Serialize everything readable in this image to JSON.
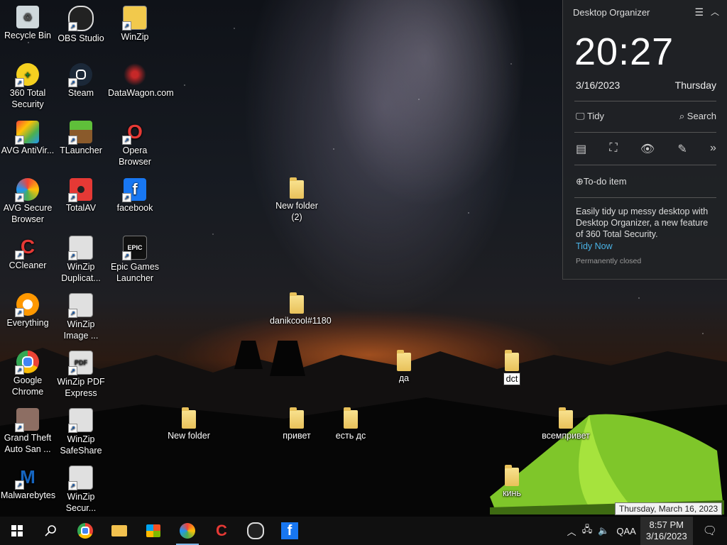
{
  "desktop": {
    "icons": [
      {
        "label": "Recycle Bin",
        "icon": "recycle-bin-icon"
      },
      {
        "label": "OBS Studio",
        "icon": "obs-studio-icon"
      },
      {
        "label": "WinZip",
        "icon": "winzip-icon"
      },
      {
        "label": "360 Total Security",
        "icon": "360-total-security-icon"
      },
      {
        "label": "Steam",
        "icon": "steam-icon"
      },
      {
        "label": "DataWagon.com",
        "icon": "datawagon-icon"
      },
      {
        "label": "AVG AntiVir...",
        "icon": "avg-antivirus-icon"
      },
      {
        "label": "TLauncher",
        "icon": "tlauncher-icon"
      },
      {
        "label": "Opera Browser",
        "icon": "opera-icon"
      },
      {
        "label": "AVG Secure Browser",
        "icon": "avg-secure-browser-icon"
      },
      {
        "label": "TotalAV",
        "icon": "totalav-icon"
      },
      {
        "label": "facebook",
        "icon": "facebook-icon"
      },
      {
        "label": "CCleaner",
        "icon": "ccleaner-icon"
      },
      {
        "label": "WinZip Duplicat...",
        "icon": "winzip-duplicate-icon"
      },
      {
        "label": "Epic Games Launcher",
        "icon": "epic-games-icon"
      },
      {
        "label": "Everything",
        "icon": "everything-icon"
      },
      {
        "label": "WinZip Image ...",
        "icon": "winzip-image-icon"
      },
      {
        "label": "Google Chrome",
        "icon": "chrome-icon"
      },
      {
        "label": "WinZip PDF Express",
        "icon": "winzip-pdf-icon"
      },
      {
        "label": "Grand Theft Auto San ...",
        "icon": "gta-icon"
      },
      {
        "label": "WinZip SafeShare",
        "icon": "winzip-safeshare-icon"
      },
      {
        "label": "Malwarebytes",
        "icon": "malwarebytes-icon"
      },
      {
        "label": "WinZip Secur...",
        "icon": "winzip-secure-icon"
      }
    ],
    "folders": [
      {
        "label": "New folder (2)"
      },
      {
        "label": "danikcool#1180"
      },
      {
        "label": "да"
      },
      {
        "label": "dct"
      },
      {
        "label": "New folder"
      },
      {
        "label": "привет"
      },
      {
        "label": "есть дс"
      },
      {
        "label": "всемпривет"
      },
      {
        "label": "кинь"
      }
    ]
  },
  "organizer": {
    "title": "Desktop Organizer",
    "time": "20:27",
    "date": "3/16/2023",
    "day": "Thursday",
    "tidy_label": "Tidy",
    "search_label": "Search",
    "todo_label": "To-do item",
    "description": "Easily tidy up messy desktop with Desktop Organizer, a new feature of 360 Total Security.",
    "tidy_now": "Tidy Now",
    "permanently_closed": "Permanently closed"
  },
  "taskbar": {
    "language": "QAA",
    "time": "8:57 PM",
    "date": "3/16/2023",
    "tooltip": "Thursday, March 16, 2023"
  },
  "colors": {
    "accent_link": "#4ab3e6",
    "taskbar": "#101010"
  }
}
